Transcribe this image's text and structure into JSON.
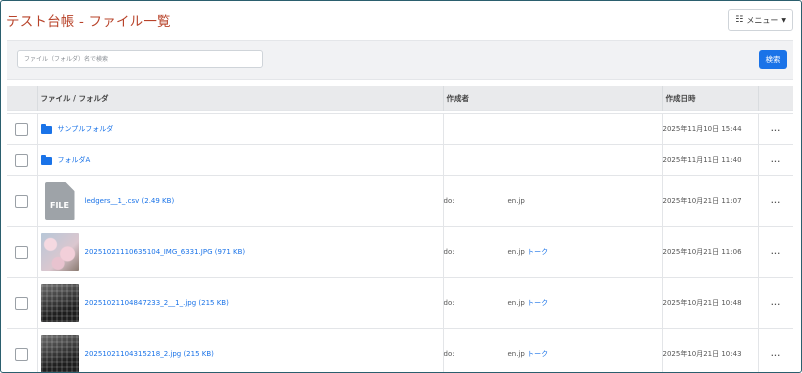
{
  "header": {
    "title": "テスト台帳 - ファイル一覧",
    "menu_label": "メニュー"
  },
  "search": {
    "placeholder": "ファイル（フォルダ）名で検索",
    "button_label": "検索"
  },
  "table": {
    "columns": [
      "ファイル / フォルダ",
      "作成者",
      "作成日時"
    ],
    "rows": [
      {
        "type": "folder",
        "name": "サンプルフォルダ",
        "author_id": "",
        "author_domain": "",
        "talk": "",
        "date": "2025年11月10日 15:44",
        "more": "..."
      },
      {
        "type": "folder",
        "name": "フォルダA",
        "author_id": "",
        "author_domain": "",
        "talk": "",
        "date": "2025年11月11日 11:40",
        "more": "..."
      },
      {
        "type": "file",
        "thumb_label": "FILE",
        "name": "ledgers__1_.csv (2.49 KB)",
        "author_id": "do:",
        "author_domain": "en.jp",
        "talk": "",
        "date": "2025年10月21日 11:07",
        "more": "..."
      },
      {
        "type": "image",
        "name": "20251021110635104_IMG_6331.JPG (971 KB)",
        "author_id": "do:",
        "author_domain": "en.jp",
        "talk": "トーク",
        "date": "2025年10月21日 11:06",
        "more": "..."
      },
      {
        "type": "image",
        "name": "20251021104847233_2__1_.jpg (215 KB)",
        "author_id": "do:",
        "author_domain": "en.jp",
        "talk": "トーク",
        "date": "2025年10月21日 10:48",
        "more": "..."
      },
      {
        "type": "image",
        "name": "20251021104315218_2.jpg (215 KB)",
        "author_id": "do:",
        "author_domain": "en.jp",
        "talk": "トーク",
        "date": "2025年10月21日 10:43",
        "more": "..."
      }
    ]
  },
  "colors": {
    "title": "#b8432a",
    "accent": "#1a73e8",
    "frame": "#2b5f6e"
  }
}
